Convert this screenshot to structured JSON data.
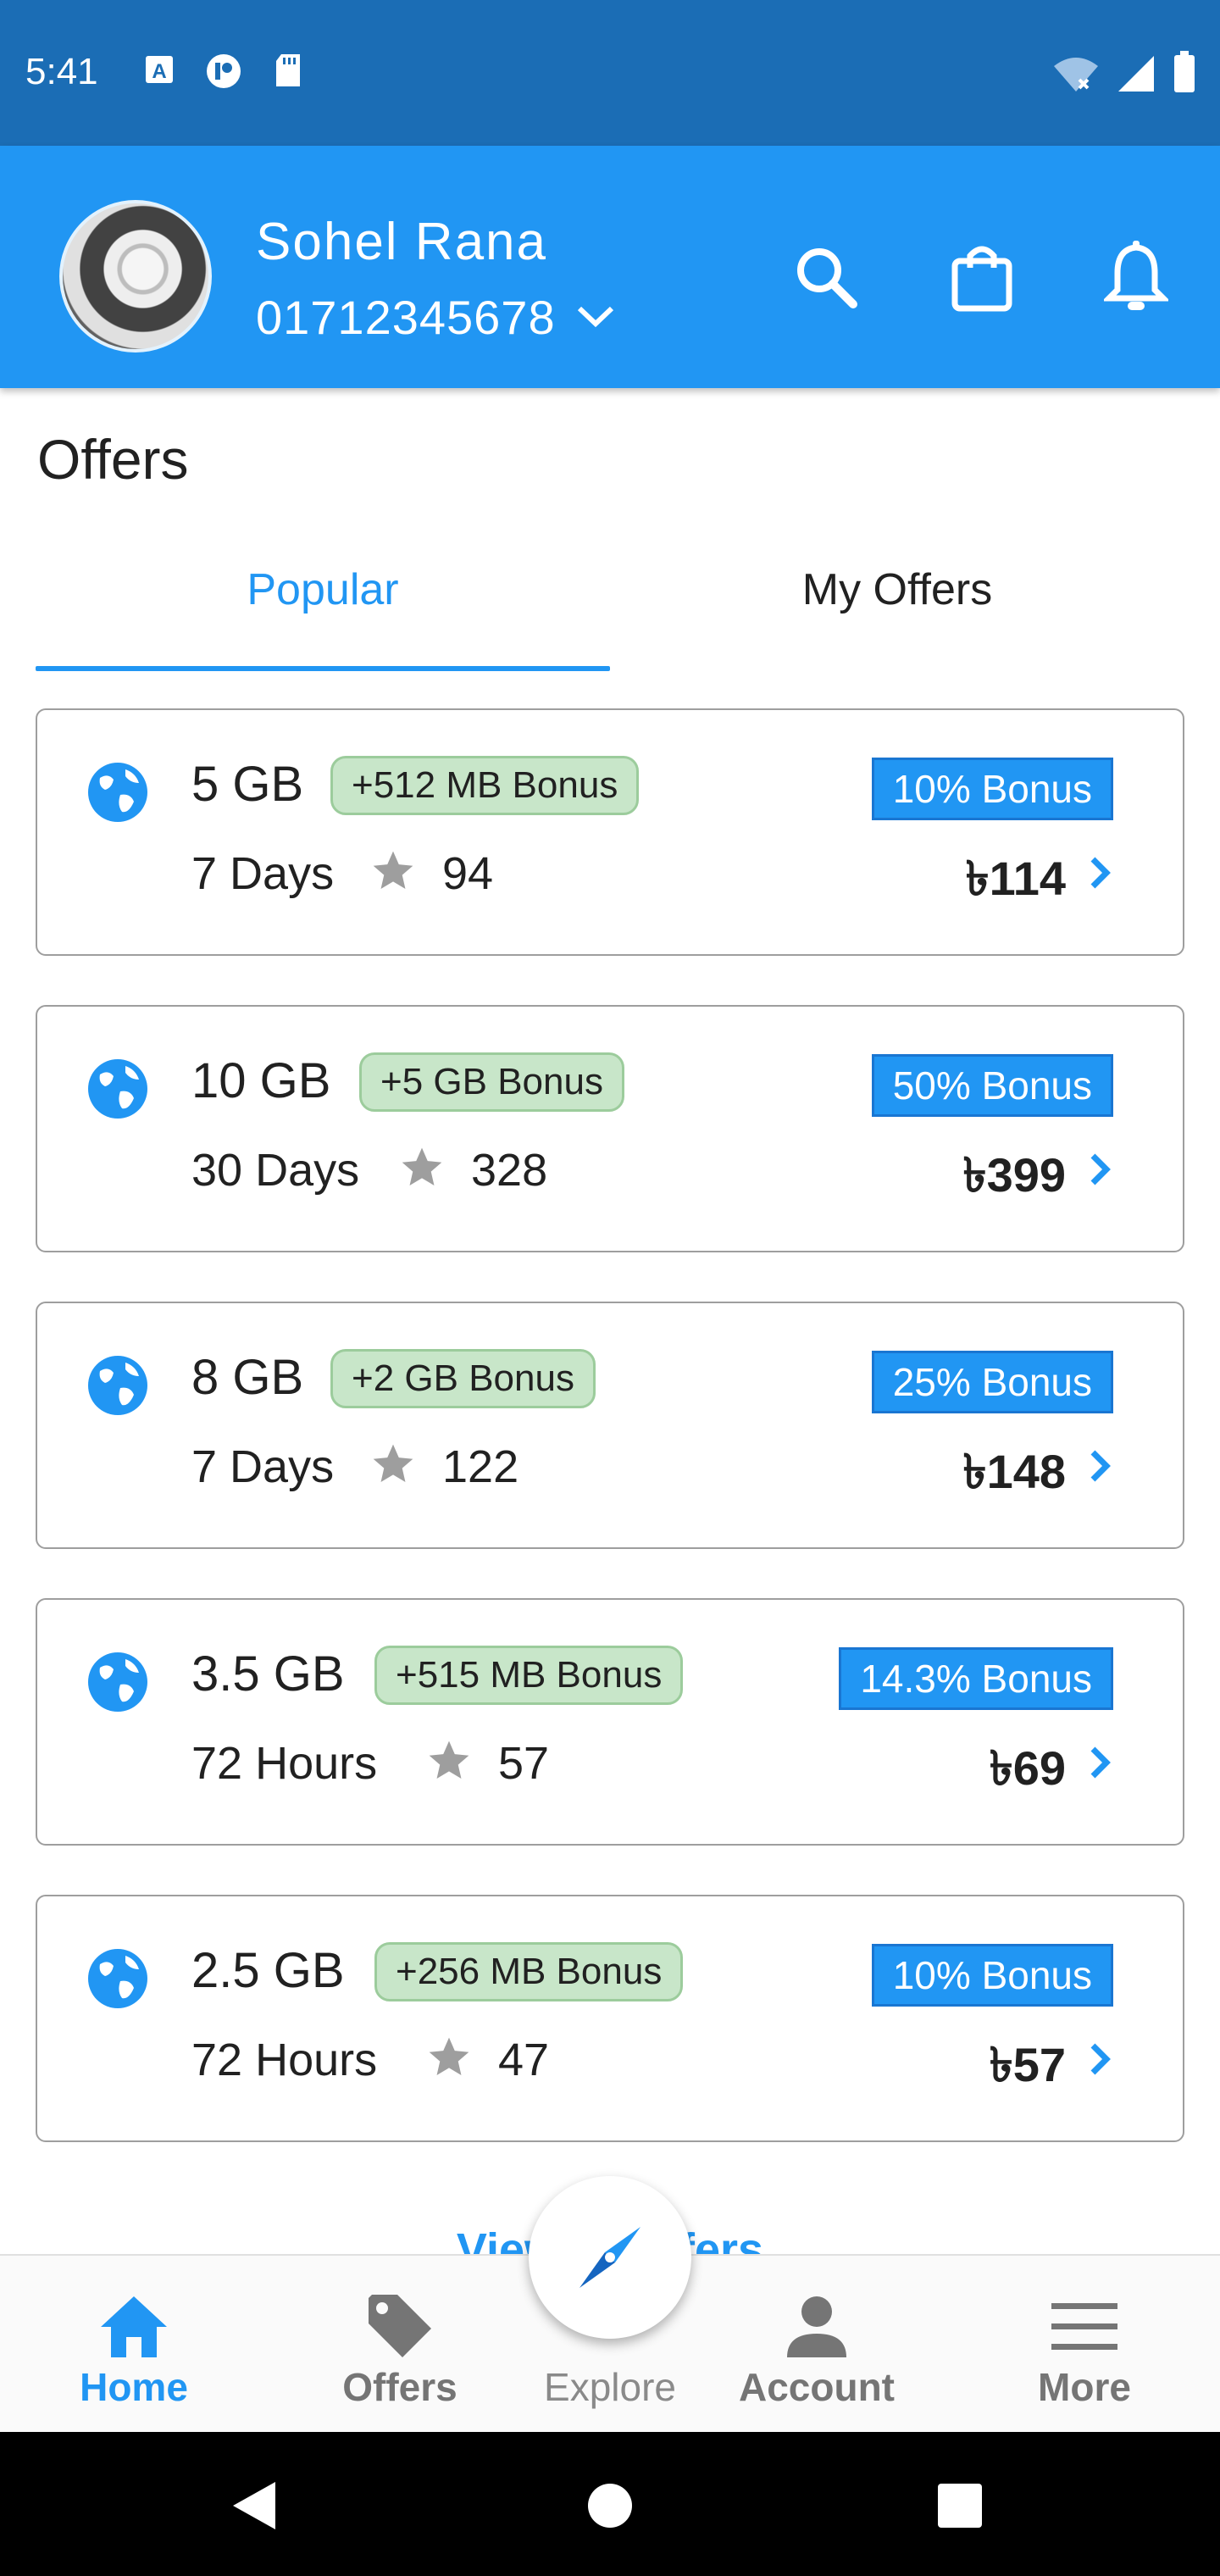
{
  "status_bar": {
    "time": "5:41",
    "left_icons": [
      "a-icon",
      "p-icon",
      "sd-card-icon"
    ],
    "right_icons": [
      "wifi-icon",
      "signal-icon",
      "battery-icon"
    ]
  },
  "header": {
    "user_name": "Sohel Rana",
    "phone_number": "01712345678",
    "actions": [
      "search-icon",
      "shopping-bag-icon",
      "bell-icon"
    ],
    "color": "#2196f3"
  },
  "offers_section": {
    "title": "Offers",
    "tabs": [
      {
        "label": "Popular",
        "active": true
      },
      {
        "label": "My Offers",
        "active": false
      }
    ]
  },
  "offers": [
    {
      "data": "5 GB",
      "bonus": "+512 MB Bonus",
      "validity": "7 Days",
      "rating": "94",
      "percent_bonus": "10% Bonus",
      "price": "৳114"
    },
    {
      "data": "10 GB",
      "bonus": "+5 GB Bonus",
      "validity": "30 Days",
      "rating": "328",
      "percent_bonus": "50% Bonus",
      "price": "৳399"
    },
    {
      "data": "8 GB",
      "bonus": "+2 GB Bonus",
      "validity": "7 Days",
      "rating": "122",
      "percent_bonus": "25% Bonus",
      "price": "৳148"
    },
    {
      "data": "3.5 GB",
      "bonus": "+515 MB Bonus",
      "validity": "72 Hours",
      "rating": "57",
      "percent_bonus": "14.3% Bonus",
      "price": "৳69"
    },
    {
      "data": "2.5 GB",
      "bonus": "+256 MB Bonus",
      "validity": "72 Hours",
      "rating": "47",
      "percent_bonus": "10% Bonus",
      "price": "৳57"
    }
  ],
  "view_all_label": "View all offers",
  "bottom_nav": {
    "items": [
      {
        "label": "Home",
        "icon": "home-icon",
        "active": true
      },
      {
        "label": "Offers",
        "icon": "tag-icon",
        "active": false
      },
      {
        "label": "Explore",
        "icon": "compass-icon",
        "active": false
      },
      {
        "label": "Account",
        "icon": "person-icon",
        "active": false
      },
      {
        "label": "More",
        "icon": "menu-icon",
        "active": false
      }
    ]
  },
  "system_nav": [
    "back-icon",
    "home-circle-icon",
    "recents-icon"
  ]
}
